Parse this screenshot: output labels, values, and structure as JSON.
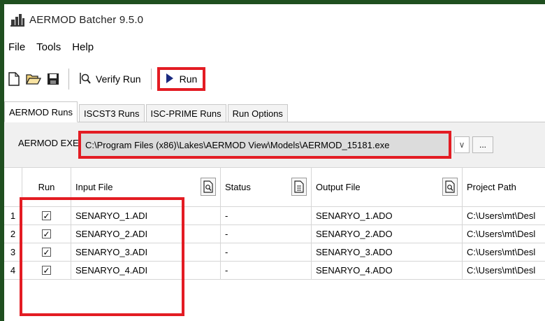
{
  "window": {
    "title": "AERMOD Batcher 9.5.0"
  },
  "menu": [
    "File",
    "Tools",
    "Help"
  ],
  "toolbar": {
    "new_icon": "new-document-icon",
    "open_icon": "open-folder-icon",
    "save_icon": "save-icon",
    "verify_label": "Verify Run",
    "run_label": "Run"
  },
  "tabs": [
    "AERMOD Runs",
    "ISCST3 Runs",
    "ISC-PRIME Runs",
    "Run Options"
  ],
  "exe": {
    "label": "AERMOD EXE",
    "path": "C:\\Program Files (x86)\\Lakes\\AERMOD View\\Models\\AERMOD_15181.exe",
    "browse_label": "..."
  },
  "grid": {
    "headers": [
      "Run",
      "Input File",
      "Status",
      "Output File",
      "Project Path"
    ],
    "rows": [
      {
        "num": "1",
        "checked": true,
        "input": "SENARYO_1.ADI",
        "status": "-",
        "output": "SENARYO_1.ADO",
        "path": "C:\\Users\\mt\\Desl"
      },
      {
        "num": "2",
        "checked": true,
        "input": "SENARYO_2.ADI",
        "status": "-",
        "output": "SENARYO_2.ADO",
        "path": "C:\\Users\\mt\\Desl"
      },
      {
        "num": "3",
        "checked": true,
        "input": "SENARYO_3.ADI",
        "status": "-",
        "output": "SENARYO_3.ADO",
        "path": "C:\\Users\\mt\\Desl"
      },
      {
        "num": "4",
        "checked": true,
        "input": "SENARYO_4.ADI",
        "status": "-",
        "output": "SENARYO_4.ADO",
        "path": "C:\\Users\\mt\\Desl"
      }
    ]
  },
  "colors": {
    "highlight": "#e31c23",
    "frame": "#1f4f1f",
    "run_arrow": "#1a2a80"
  }
}
